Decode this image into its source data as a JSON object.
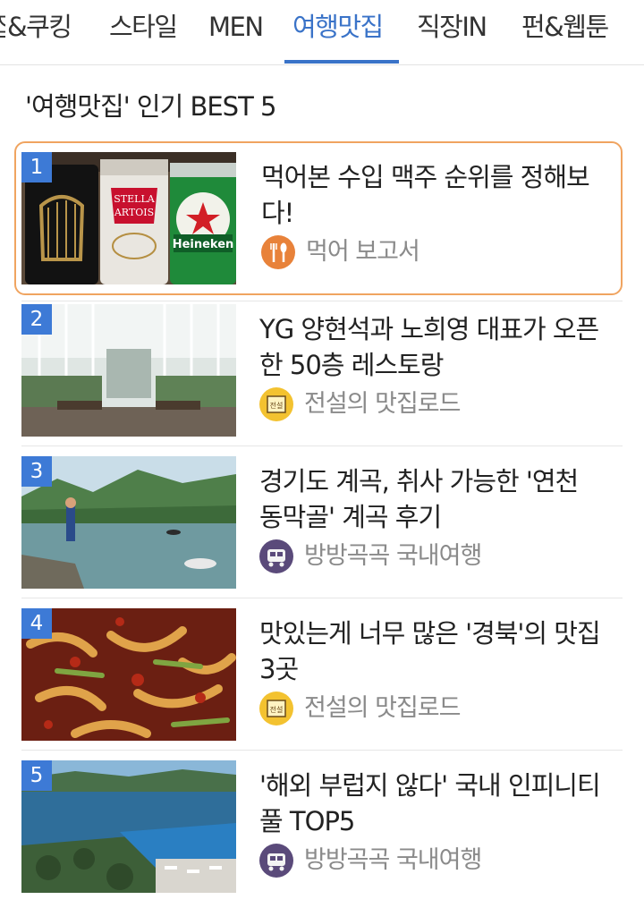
{
  "tabs": [
    {
      "label": "&쿠킹"
    },
    {
      "label": "스타일"
    },
    {
      "label": "MEN"
    },
    {
      "label": "여행맛집"
    },
    {
      "label": "직장IN"
    },
    {
      "label": "펀&웹툰"
    }
  ],
  "tabs_partial_prefix": "집",
  "active_tab": "여행맛집",
  "section_title": "'여행맛집' 인기 BEST 5",
  "items": [
    {
      "rank": "1",
      "title": "먹어본 수입 맥주 순위를 정해보다!",
      "source": "먹어 보고서",
      "source_icon": "fork-spoon-icon"
    },
    {
      "rank": "2",
      "title": "YG 양현석과 노희영 대표가 오픈한 50층 레스토랑",
      "source": "전설의 맛집로드",
      "source_icon": "legend-badge-icon"
    },
    {
      "rank": "3",
      "title": "경기도 계곡, 취사 가능한 '연천 동막골' 계곡 후기",
      "source": "방방곡곡 국내여행",
      "source_icon": "train-icon"
    },
    {
      "rank": "4",
      "title": "맛있는게 너무 많은 '경북'의 맛집 3곳",
      "source": "전설의 맛집로드",
      "source_icon": "legend-badge-icon"
    },
    {
      "rank": "5",
      "title": "'해외 부럽지 않다' 국내 인피니티 풀 TOP5",
      "source": "방방곡곡 국내여행",
      "source_icon": "train-icon"
    }
  ],
  "thumbnail_text": {
    "brand_a": "STELLA",
    "brand_b": "ARTOIS",
    "brand_c": "Heineken",
    "badge": "전설"
  },
  "colors": {
    "accent": "#3a73c8",
    "rank_badge": "#3d7ad6",
    "highlight_border": "#f0a460",
    "source_text": "#8a8a8a"
  }
}
